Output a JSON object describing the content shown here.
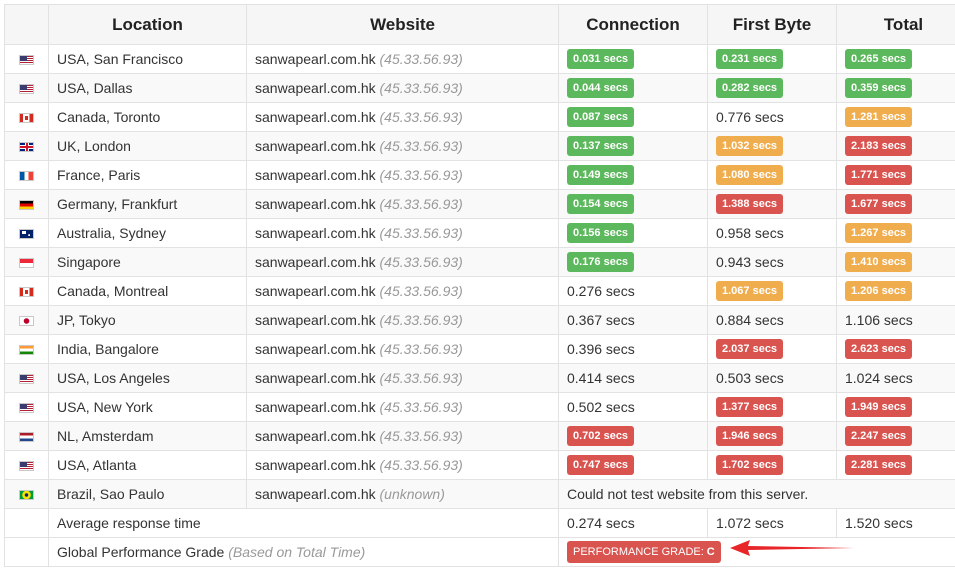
{
  "table": {
    "headers": {
      "location": "Location",
      "website": "Website",
      "connection": "Connection",
      "first_byte": "First Byte",
      "total": "Total"
    },
    "rows": [
      {
        "flag": "us",
        "location": "USA, San Francisco",
        "site": "sanwapearl.com.hk",
        "ip": "(45.33.56.93)",
        "connection": {
          "text": "0.031 secs",
          "style": "green"
        },
        "first_byte": {
          "text": "0.231 secs",
          "style": "green"
        },
        "total": {
          "text": "0.265 secs",
          "style": "green"
        }
      },
      {
        "flag": "us",
        "location": "USA, Dallas",
        "site": "sanwapearl.com.hk",
        "ip": "(45.33.56.93)",
        "connection": {
          "text": "0.044 secs",
          "style": "green"
        },
        "first_byte": {
          "text": "0.282 secs",
          "style": "green"
        },
        "total": {
          "text": "0.359 secs",
          "style": "green"
        }
      },
      {
        "flag": "ca",
        "location": "Canada, Toronto",
        "site": "sanwapearl.com.hk",
        "ip": "(45.33.56.93)",
        "connection": {
          "text": "0.087 secs",
          "style": "green"
        },
        "first_byte": {
          "text": "0.776 secs",
          "style": "plain"
        },
        "total": {
          "text": "1.281 secs",
          "style": "orange"
        }
      },
      {
        "flag": "uk",
        "location": "UK, London",
        "site": "sanwapearl.com.hk",
        "ip": "(45.33.56.93)",
        "connection": {
          "text": "0.137 secs",
          "style": "green"
        },
        "first_byte": {
          "text": "1.032 secs",
          "style": "orange"
        },
        "total": {
          "text": "2.183 secs",
          "style": "red"
        }
      },
      {
        "flag": "fr",
        "location": "France, Paris",
        "site": "sanwapearl.com.hk",
        "ip": "(45.33.56.93)",
        "connection": {
          "text": "0.149 secs",
          "style": "green"
        },
        "first_byte": {
          "text": "1.080 secs",
          "style": "orange"
        },
        "total": {
          "text": "1.771 secs",
          "style": "red"
        }
      },
      {
        "flag": "de",
        "location": "Germany, Frankfurt",
        "site": "sanwapearl.com.hk",
        "ip": "(45.33.56.93)",
        "connection": {
          "text": "0.154 secs",
          "style": "green"
        },
        "first_byte": {
          "text": "1.388 secs",
          "style": "red"
        },
        "total": {
          "text": "1.677 secs",
          "style": "red"
        }
      },
      {
        "flag": "au",
        "location": "Australia, Sydney",
        "site": "sanwapearl.com.hk",
        "ip": "(45.33.56.93)",
        "connection": {
          "text": "0.156 secs",
          "style": "green"
        },
        "first_byte": {
          "text": "0.958 secs",
          "style": "plain"
        },
        "total": {
          "text": "1.267 secs",
          "style": "orange"
        }
      },
      {
        "flag": "sg",
        "location": "Singapore",
        "site": "sanwapearl.com.hk",
        "ip": "(45.33.56.93)",
        "connection": {
          "text": "0.176 secs",
          "style": "green"
        },
        "first_byte": {
          "text": "0.943 secs",
          "style": "plain"
        },
        "total": {
          "text": "1.410 secs",
          "style": "orange"
        }
      },
      {
        "flag": "ca",
        "location": "Canada, Montreal",
        "site": "sanwapearl.com.hk",
        "ip": "(45.33.56.93)",
        "connection": {
          "text": "0.276 secs",
          "style": "plain"
        },
        "first_byte": {
          "text": "1.067 secs",
          "style": "orange"
        },
        "total": {
          "text": "1.206 secs",
          "style": "orange"
        }
      },
      {
        "flag": "jp",
        "location": "JP, Tokyo",
        "site": "sanwapearl.com.hk",
        "ip": "(45.33.56.93)",
        "connection": {
          "text": "0.367 secs",
          "style": "plain"
        },
        "first_byte": {
          "text": "0.884 secs",
          "style": "plain"
        },
        "total": {
          "text": "1.106 secs",
          "style": "plain"
        }
      },
      {
        "flag": "in",
        "location": "India, Bangalore",
        "site": "sanwapearl.com.hk",
        "ip": "(45.33.56.93)",
        "connection": {
          "text": "0.396 secs",
          "style": "plain"
        },
        "first_byte": {
          "text": "2.037 secs",
          "style": "red"
        },
        "total": {
          "text": "2.623 secs",
          "style": "red"
        }
      },
      {
        "flag": "us",
        "location": "USA, Los Angeles",
        "site": "sanwapearl.com.hk",
        "ip": "(45.33.56.93)",
        "connection": {
          "text": "0.414 secs",
          "style": "plain"
        },
        "first_byte": {
          "text": "0.503 secs",
          "style": "plain"
        },
        "total": {
          "text": "1.024 secs",
          "style": "plain"
        }
      },
      {
        "flag": "us",
        "location": "USA, New York",
        "site": "sanwapearl.com.hk",
        "ip": "(45.33.56.93)",
        "connection": {
          "text": "0.502 secs",
          "style": "plain"
        },
        "first_byte": {
          "text": "1.377 secs",
          "style": "red"
        },
        "total": {
          "text": "1.949 secs",
          "style": "red"
        }
      },
      {
        "flag": "nl",
        "location": "NL, Amsterdam",
        "site": "sanwapearl.com.hk",
        "ip": "(45.33.56.93)",
        "connection": {
          "text": "0.702 secs",
          "style": "red"
        },
        "first_byte": {
          "text": "1.946 secs",
          "style": "red"
        },
        "total": {
          "text": "2.247 secs",
          "style": "red"
        }
      },
      {
        "flag": "us",
        "location": "USA, Atlanta",
        "site": "sanwapearl.com.hk",
        "ip": "(45.33.56.93)",
        "connection": {
          "text": "0.747 secs",
          "style": "red"
        },
        "first_byte": {
          "text": "1.702 secs",
          "style": "red"
        },
        "total": {
          "text": "2.281 secs",
          "style": "red"
        }
      },
      {
        "flag": "br",
        "location": "Brazil, Sao Paulo",
        "site": "sanwapearl.com.hk",
        "ip": "(unknown)",
        "message": "Could not test website from this server."
      }
    ],
    "average": {
      "label": "Average response time",
      "connection": "0.274 secs",
      "first_byte": "1.072 secs",
      "total": "1.520 secs"
    },
    "grade": {
      "label": "Global Performance Grade",
      "note": "(Based on Total Time)",
      "badge_label": "PERFORMANCE GRADE:",
      "badge_value": "C"
    }
  },
  "colors": {
    "green": "#5cb85c",
    "orange": "#f0ad4e",
    "red": "#d9534f",
    "arrow": "#e8262a"
  }
}
